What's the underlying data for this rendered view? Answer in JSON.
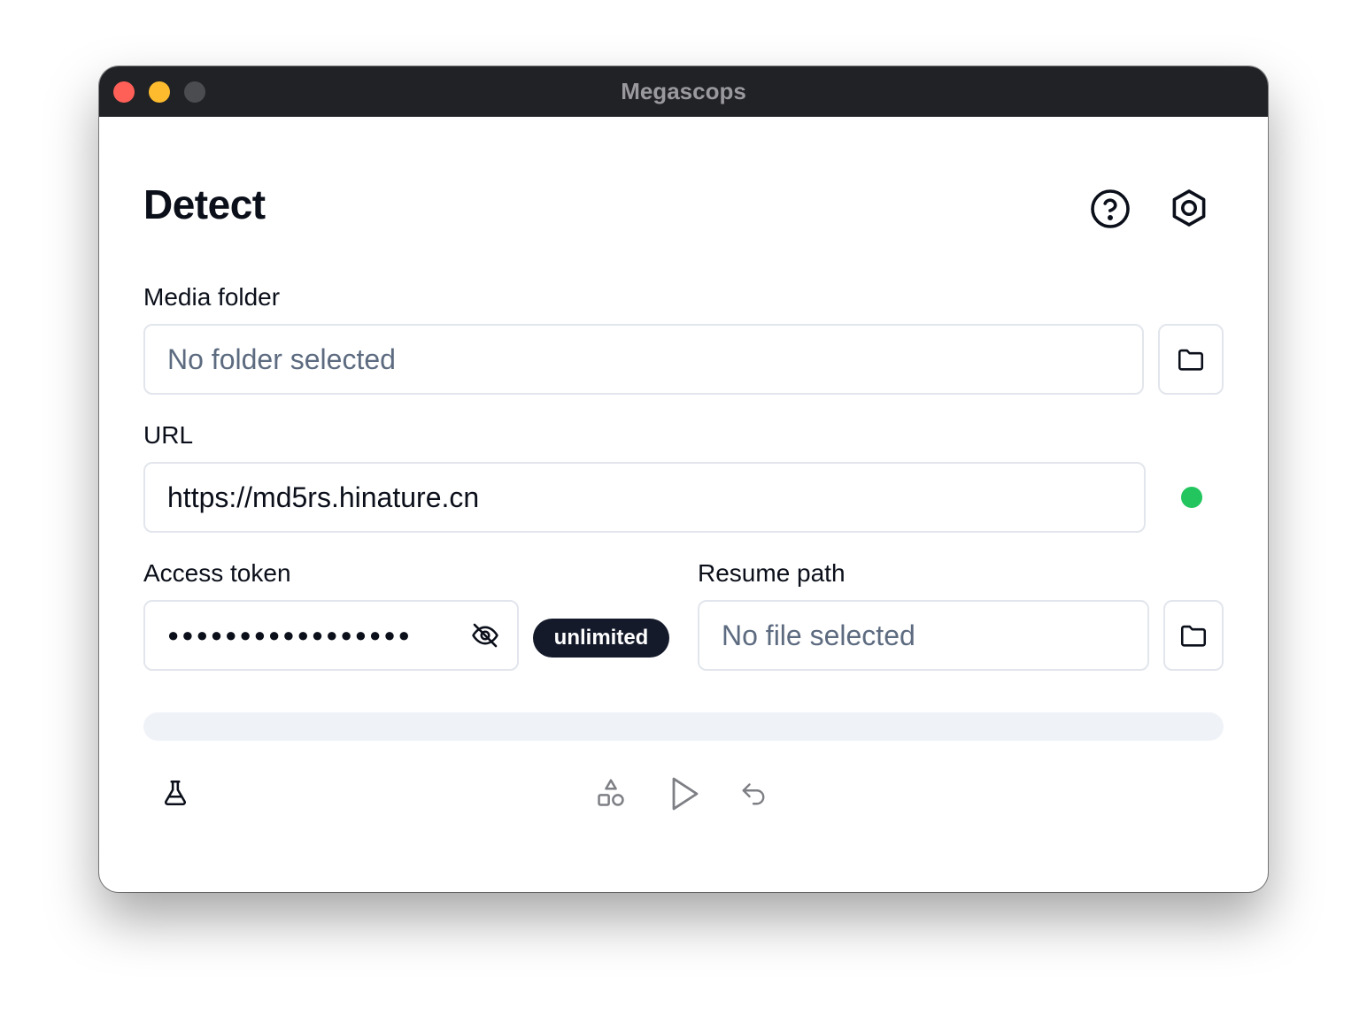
{
  "window": {
    "title": "Megascops"
  },
  "page": {
    "title": "Detect"
  },
  "header_icons": {
    "help": "help-circle-icon",
    "settings": "settings-hexagon-icon"
  },
  "media_folder": {
    "label": "Media folder",
    "placeholder": "No folder selected",
    "browse_icon": "folder-icon"
  },
  "url": {
    "label": "URL",
    "value": "https://md5rs.hinature.cn",
    "status": "connected",
    "status_color": "#22c55e"
  },
  "access_token": {
    "label": "Access token",
    "masked_value": "●●●●●●●●●●●●●●●●●",
    "visibility_icon": "eye-off-icon",
    "quota_badge": "unlimited"
  },
  "resume_path": {
    "label": "Resume path",
    "placeholder": "No file selected",
    "browse_icon": "folder-icon"
  },
  "progress": {
    "percent": 0
  },
  "toolbar": {
    "left_icon": "flask-icon",
    "center_icons": [
      "shapes-icon",
      "play-icon",
      "undo-icon"
    ]
  },
  "colors": {
    "titlebar": "#212226",
    "badge_bg": "#141a2a",
    "placeholder": "#5d6b80",
    "border": "#e2e6ec",
    "progress_track": "#eff2f7"
  }
}
